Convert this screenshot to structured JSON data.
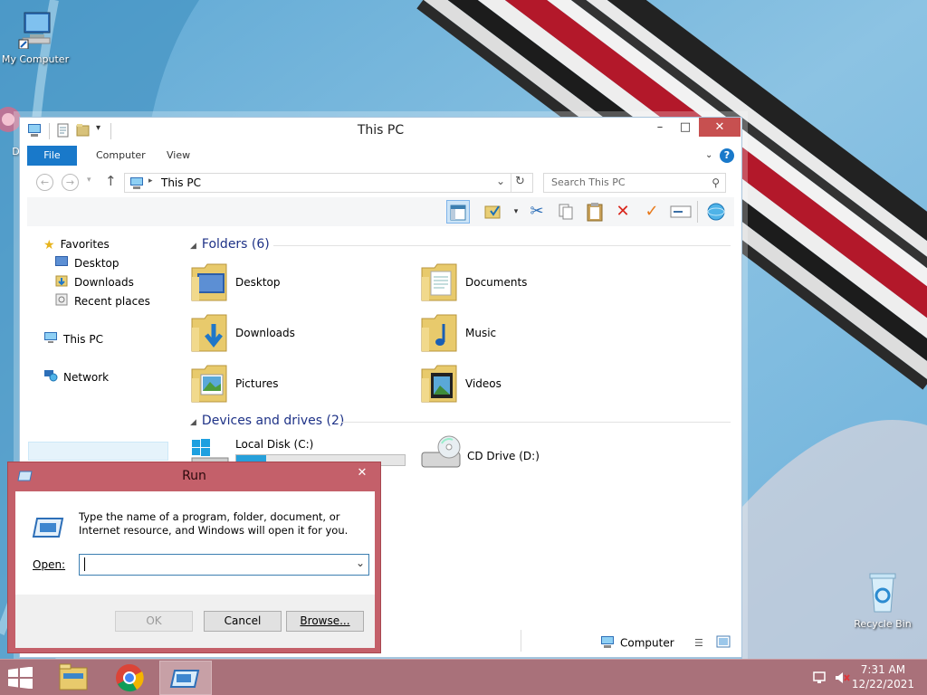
{
  "desktop": {
    "icons": [
      {
        "label": "My Computer"
      },
      {
        "label": "Dat"
      },
      {
        "label": "Recycle Bin"
      }
    ]
  },
  "explorer": {
    "title": "This PC",
    "tabs": [
      "File",
      "Computer",
      "View"
    ],
    "address": "This PC",
    "search_placeholder": "Search This PC",
    "nav": {
      "favorites": "Favorites",
      "favorite_items": [
        "Desktop",
        "Downloads",
        "Recent places"
      ],
      "this_pc": "This PC",
      "network": "Network"
    },
    "folders_header": "Folders (6)",
    "folders": [
      "Desktop",
      "Documents",
      "Downloads",
      "Music",
      "Pictures",
      "Videos"
    ],
    "drives_header": "Devices and drives (2)",
    "drives": [
      {
        "label": "Local Disk (C:)",
        "used_fraction": 0.18
      },
      {
        "label": "CD Drive (D:)"
      }
    ],
    "status_location": "Computer"
  },
  "run": {
    "title": "Run",
    "description": "Type the name of a program, folder, document, or Internet resource, and Windows will open it for you.",
    "open_label": "Open:",
    "open_value": "",
    "ok": "OK",
    "cancel": "Cancel",
    "browse": "Browse..."
  },
  "taskbar": {
    "time": "7:31 AM",
    "date": "12/22/2021"
  }
}
